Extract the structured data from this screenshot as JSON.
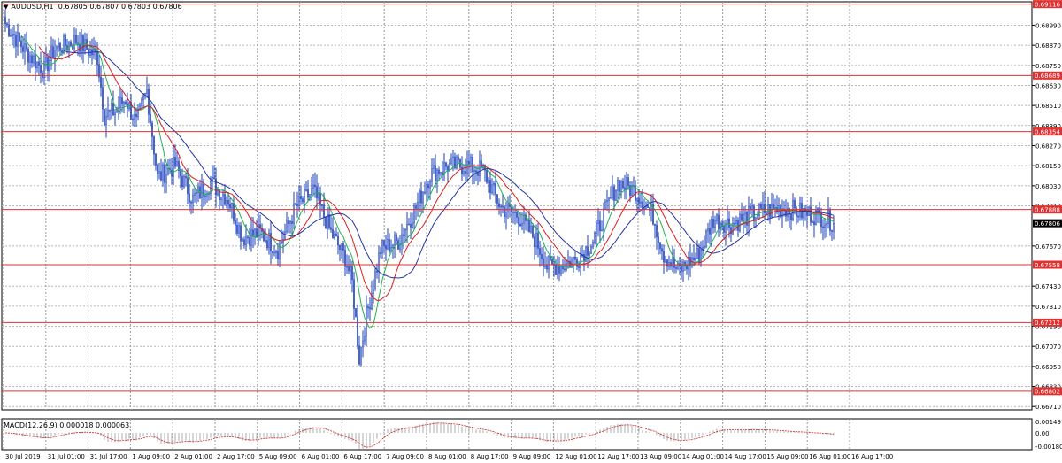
{
  "header": {
    "symbol": "AUDUSD,H1",
    "ohlc": "0.67805 0.67807 0.67803 0.67806"
  },
  "macd": {
    "label": "MACD(12,26,9) 0.000018 0.000063",
    "y_ticks": [
      "0.001491",
      "0.00",
      "-0.001808"
    ]
  },
  "colors": {
    "candle": "#1a3fbf",
    "ma_fast": "#22b14c",
    "ma_mid": "#d62020",
    "ma_slow": "#2433a0",
    "level_line": "#e03030",
    "level_box": "#e03030",
    "current_box": "#000000",
    "macd_hist": "#9a9a9a",
    "macd_signal": "#cc2222"
  },
  "chart_data": {
    "type": "candlestick",
    "x_labels": [
      "30 Jul 2019",
      "31 Jul 01:00",
      "31 Jul 17:00",
      "1 Aug 09:00",
      "2 Aug 01:00",
      "2 Aug 17:00",
      "5 Aug 09:00",
      "6 Aug 01:00",
      "6 Aug 17:00",
      "7 Aug 09:00",
      "8 Aug 01:00",
      "8 Aug 17:00",
      "9 Aug 09:00",
      "12 Aug 01:00",
      "12 Aug 17:00",
      "13 Aug 09:00",
      "14 Aug 01:00",
      "14 Aug 17:00",
      "15 Aug 09:00",
      "16 Aug 01:00",
      "16 Aug 17:00"
    ],
    "y_ticks": [
      0.6899,
      0.6887,
      0.6875,
      0.6863,
      0.6851,
      0.6839,
      0.6827,
      0.6815,
      0.6803,
      0.6791,
      0.6767,
      0.6743,
      0.6731,
      0.6719,
      0.6707,
      0.6695,
      0.6683,
      0.6671
    ],
    "y_tick_labels": [
      "0.68990",
      "0.68870",
      "0.68750",
      "0.68630",
      "0.68510",
      "0.68390",
      "0.68270",
      "0.68150",
      "0.68030",
      "0.67910",
      "0.67670",
      "0.67430",
      "0.67310",
      "0.67190",
      "0.67070",
      "0.66950",
      "0.66830",
      "0.66710"
    ],
    "ylim": [
      0.6669,
      0.6913
    ],
    "levels": [
      0.69116,
      0.68689,
      0.68354,
      0.67888,
      0.67558,
      0.67212,
      0.66802
    ],
    "level_labels": [
      "0.69116",
      "0.68689",
      "0.68354",
      "0.67888",
      "0.67558",
      "0.67212",
      "0.66802"
    ],
    "current_price": 0.67806,
    "current_label": "0.67806",
    "anchors": [
      [
        0,
        0.69
      ],
      [
        12,
        0.6883
      ],
      [
        22,
        0.6872
      ],
      [
        28,
        0.6885
      ],
      [
        40,
        0.689
      ],
      [
        52,
        0.688
      ],
      [
        56,
        0.6845
      ],
      [
        62,
        0.6848
      ],
      [
        68,
        0.6855
      ],
      [
        74,
        0.684
      ],
      [
        80,
        0.686
      ],
      [
        86,
        0.6808
      ],
      [
        96,
        0.6815
      ],
      [
        106,
        0.6795
      ],
      [
        116,
        0.6805
      ],
      [
        126,
        0.6795
      ],
      [
        134,
        0.6772
      ],
      [
        144,
        0.6775
      ],
      [
        154,
        0.6765
      ],
      [
        164,
        0.679
      ],
      [
        174,
        0.68
      ],
      [
        184,
        0.6775
      ],
      [
        192,
        0.676
      ],
      [
        196,
        0.6745
      ],
      [
        200,
        0.67
      ],
      [
        204,
        0.6725
      ],
      [
        212,
        0.6765
      ],
      [
        222,
        0.677
      ],
      [
        232,
        0.679
      ],
      [
        240,
        0.681
      ],
      [
        250,
        0.6815
      ],
      [
        262,
        0.6815
      ],
      [
        270,
        0.6812
      ],
      [
        280,
        0.679
      ],
      [
        290,
        0.6785
      ],
      [
        300,
        0.677
      ],
      [
        306,
        0.6755
      ],
      [
        314,
        0.6755
      ],
      [
        324,
        0.676
      ],
      [
        332,
        0.677
      ],
      [
        340,
        0.679
      ],
      [
        346,
        0.6805
      ],
      [
        356,
        0.68
      ],
      [
        366,
        0.6785
      ],
      [
        372,
        0.6762
      ],
      [
        380,
        0.6752
      ],
      [
        392,
        0.6762
      ],
      [
        400,
        0.6783
      ],
      [
        410,
        0.678
      ],
      [
        420,
        0.6785
      ],
      [
        430,
        0.6788
      ],
      [
        440,
        0.679
      ],
      [
        450,
        0.6787
      ],
      [
        460,
        0.6785
      ],
      [
        468,
        0.6781
      ]
    ],
    "n_candles": 469
  }
}
